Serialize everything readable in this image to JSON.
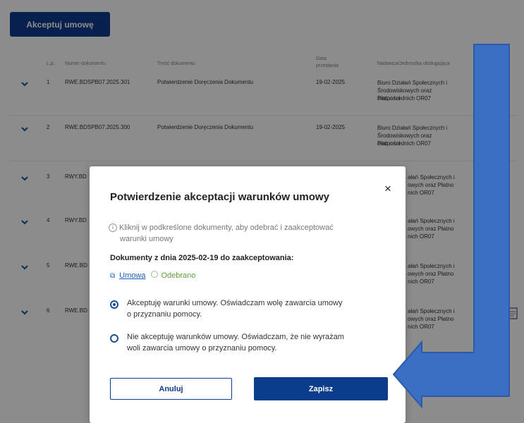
{
  "toolbar": {
    "accept_label": "Akceptuj umowę"
  },
  "table": {
    "headers": {
      "lp": "L.p.",
      "numer": "Numer dokumentu",
      "tresc": "Treść dokumentu",
      "data_line1": "Data",
      "data_line2": "przesłania",
      "nadawca": "Nadawca/Jednostka obsługująca"
    },
    "rows": [
      {
        "lp": "1",
        "numer": "RWE.BDSPB07.2025.301",
        "tresc": "Potwierdzenie Doręczenia Dokumentu",
        "data": "19-02-2025",
        "nad1": "Biuro Działań Społecznych i",
        "nad2": "Środowiskowych oraz Płatności",
        "nad3": "Bezpośrednich OR07"
      },
      {
        "lp": "2",
        "numer": "RWE.BDSPB07.2025.300",
        "tresc": "Potwierdzenie Doręczenia Dokumentu",
        "data": "19-02-2025",
        "nad1": "Biuro Działań Społecznych i",
        "nad2": "Środowiskowych oraz Płatności",
        "nad3": "Bezpośrednich OR07"
      },
      {
        "lp": "3",
        "numer": "RWY.BD",
        "nad1": "ałań Społecznych i",
        "nad2": "owych oraz Płatno",
        "nad3": "nich OR07"
      },
      {
        "lp": "4",
        "numer": "RWY.BD",
        "nad1": "ałań Społecznych i",
        "nad2": "owych oraz Płatno",
        "nad3": "nich OR07"
      },
      {
        "lp": "5",
        "numer": "RWE.BD",
        "nad1": "ałań Społecznych i",
        "nad2": "owych oraz Płatno",
        "nad3": "nich OR07"
      },
      {
        "lp": "6",
        "numer": "RWE.BD",
        "nad1": "ałań Społecznych i",
        "nad2": "owych oraz Płatno",
        "nad3": "nich OR07"
      }
    ]
  },
  "modal": {
    "title": "Potwierdzenie akceptacji warunków umowy",
    "close": "×",
    "info_icon": "i",
    "info_line1": "Kliknij w podkreślone dokumenty, aby odebrać i zaakceptować",
    "info_line2": "warunki umowy",
    "docs_heading": "Dokumenty z dnia 2025-02-19 do zaakceptowania:",
    "doc_link": "Umowa",
    "doc_status": "Odebrano",
    "option_accept_1": "Akceptuję warunki umowy. Oświadczam wolę zawarcia umowy",
    "option_accept_2": "o przyznaniu pomocy.",
    "option_reject_1": "Nie akceptuję warunków umowy. Oświadczam, że nie wyrażam",
    "option_reject_2": "woli zawarcia umowy o przyznaniu pomocy.",
    "selected_option": "accept",
    "cancel_label": "Anuluj",
    "save_label": "Zapisz"
  },
  "icons": {
    "row_toggle": "chevron-down-icon",
    "search": "search-icon",
    "pdf": "document-icon",
    "annotation": "arrow-right-left-icon"
  },
  "colors": {
    "primary": "#0b3d8c",
    "link": "#1a5fb4",
    "success": "#5b9f3e",
    "arrow": "#3a6fc4"
  }
}
